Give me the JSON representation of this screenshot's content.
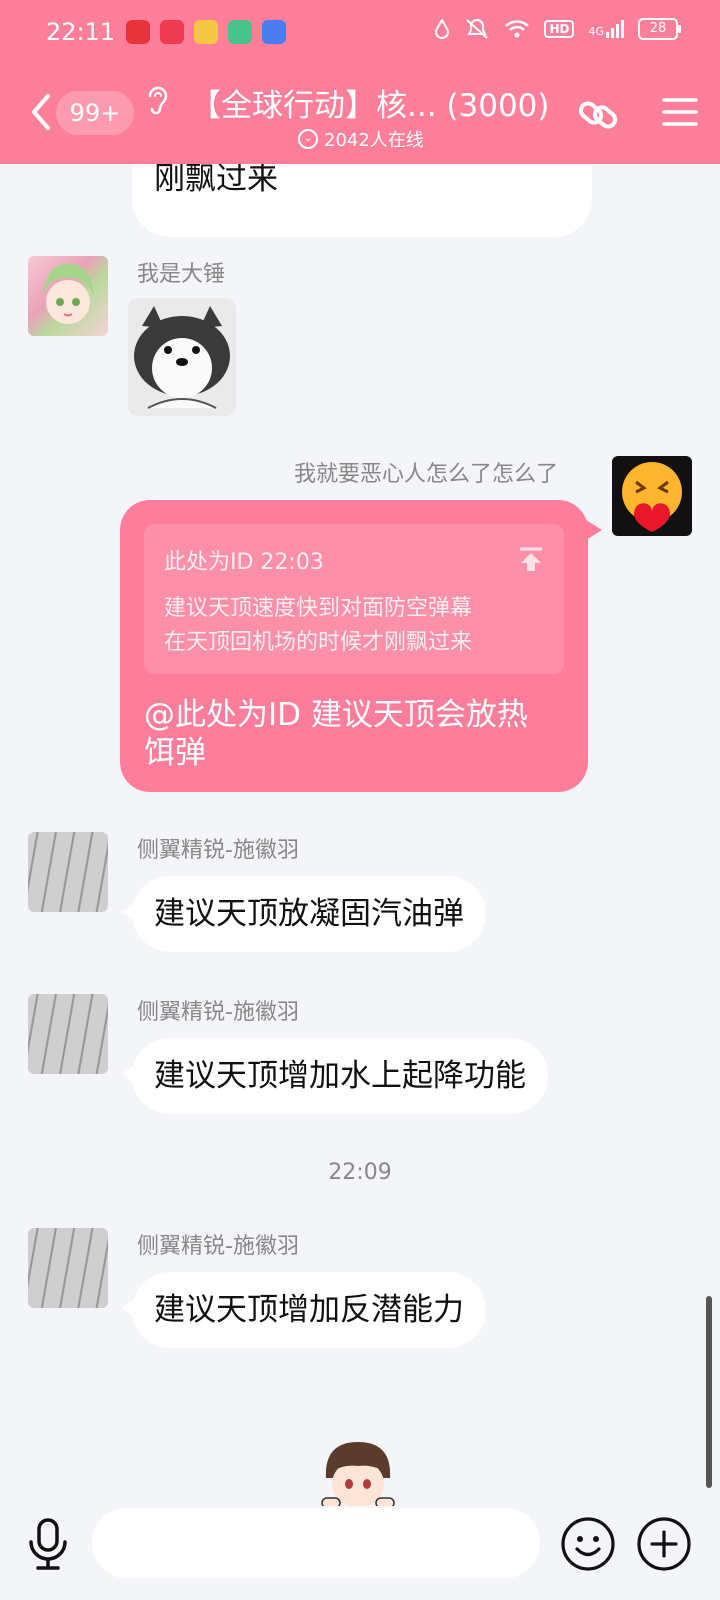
{
  "status_bar": {
    "time": "22:11",
    "network": "4G",
    "battery": "28",
    "hd": "HD"
  },
  "header": {
    "unread_count": "99+",
    "group_title": "【全球行动】核... (3000)",
    "online_text": "2042人在线"
  },
  "messages": [
    {
      "partial_text": "刚飘过来"
    },
    {
      "sender": "我是大锤",
      "type": "sticker"
    },
    {
      "sender": "我就要恶心人怎么了怎么了",
      "quote_header": "此处为ID 22:03",
      "quote_lines": [
        "建议天顶速度快到对面防空弹幕",
        "在天顶回机场的时候才刚飘过来"
      ],
      "text_lines": [
        "@此处为ID 建议天顶会放热",
        "饵弹"
      ]
    },
    {
      "sender": "侧翼精锐-施徽羽",
      "text": "建议天顶放凝固汽油弹"
    },
    {
      "sender": "侧翼精锐-施徽羽",
      "text": "建议天顶增加水上起降功能"
    },
    {
      "sender": "侧翼精锐-施徽羽",
      "text": "建议天顶增加反潜能力"
    }
  ],
  "time_divider": "22:09",
  "colors": {
    "accent": "#ff7f9a",
    "own_bubble": "#fd7d9b",
    "background": "#f4f5f9"
  },
  "icons": {
    "back": "back-chevron-icon",
    "ear": "ear-icon",
    "link": "link-icon",
    "menu": "menu-icon",
    "mic": "mic-icon",
    "emoji": "emoji-icon",
    "plus": "plus-icon"
  }
}
